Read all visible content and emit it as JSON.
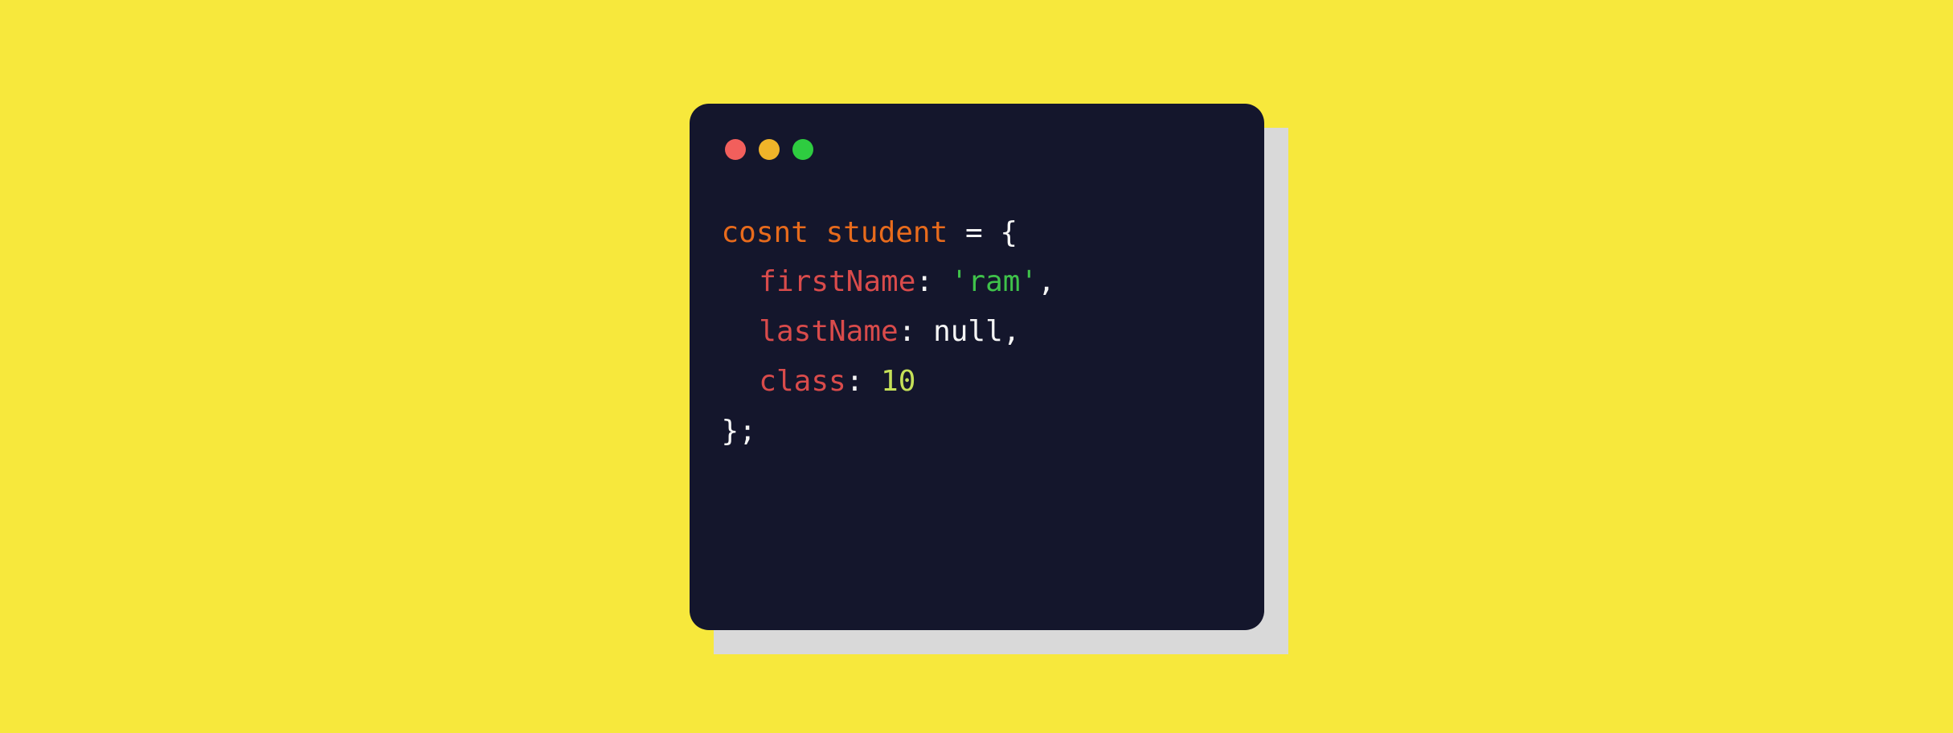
{
  "trafficLights": {
    "red": "red",
    "yellow": "yellow",
    "green": "green"
  },
  "code": {
    "line1": {
      "keyword": "cosnt",
      "variable": "student",
      "equals": "=",
      "brace": "{"
    },
    "line2": {
      "prop": "firstName",
      "colon": ":",
      "string": "'ram'",
      "comma": ","
    },
    "line3": {
      "prop": "lastName",
      "colon": ":",
      "null": "null",
      "comma": ","
    },
    "line4": {
      "prop": "class",
      "colon": ":",
      "number": "10"
    },
    "line5": {
      "brace": "}",
      "semi": ";"
    }
  }
}
